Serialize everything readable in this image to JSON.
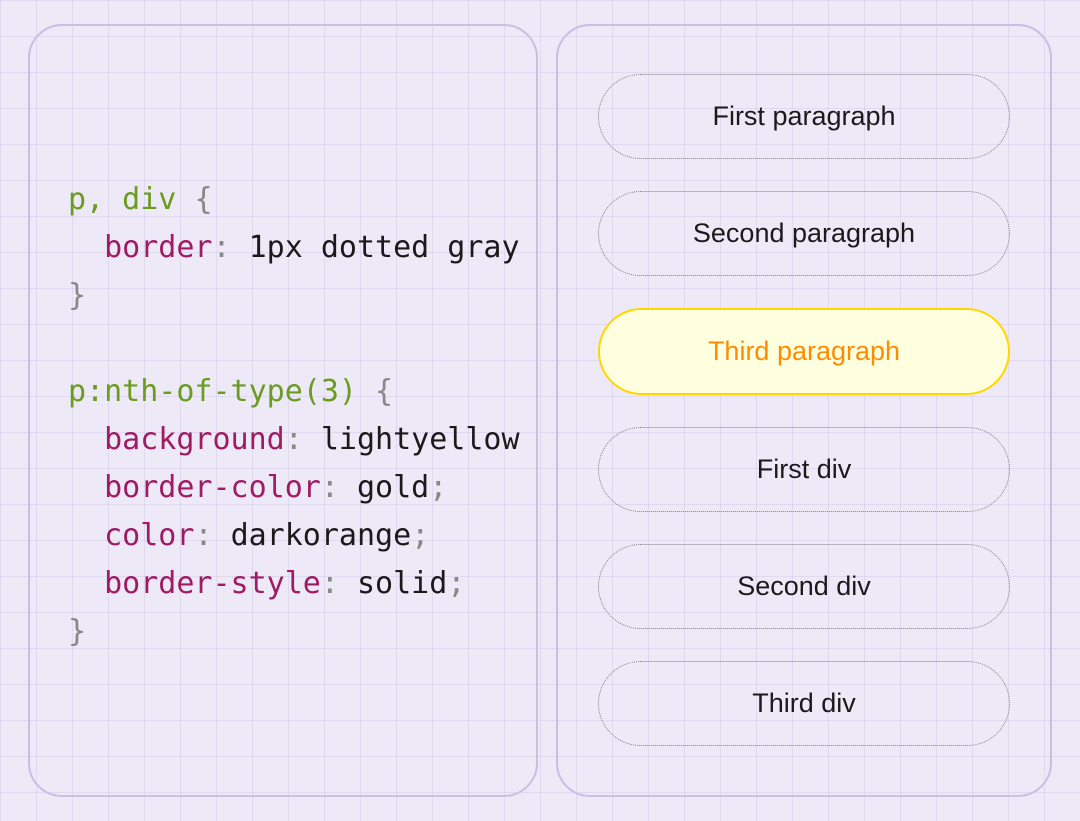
{
  "code": {
    "rule1": {
      "selector": "p, div",
      "decl1_prop": "border",
      "decl1_val": "1px dotted gray"
    },
    "rule2": {
      "selector": "p:nth-of-type(3)",
      "decl1_prop": "background",
      "decl1_val": "lightyellow",
      "decl2_prop": "border-color",
      "decl2_val": "gold",
      "decl3_prop": "color",
      "decl3_val": "darkorange",
      "decl4_prop": "border-style",
      "decl4_val": "solid"
    }
  },
  "output": {
    "items": [
      {
        "text": "First paragraph",
        "highlighted": false
      },
      {
        "text": "Second paragraph",
        "highlighted": false
      },
      {
        "text": "Third paragraph",
        "highlighted": true
      },
      {
        "text": "First div",
        "highlighted": false
      },
      {
        "text": "Second div",
        "highlighted": false
      },
      {
        "text": "Third div",
        "highlighted": false
      }
    ]
  }
}
